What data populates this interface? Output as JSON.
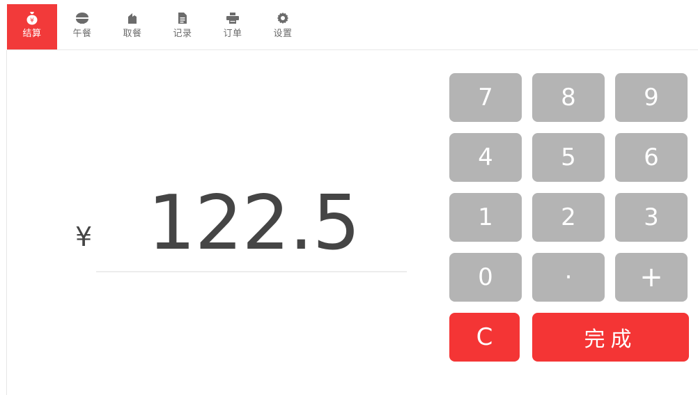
{
  "nav": {
    "tabs": [
      {
        "label": "结算",
        "icon": "money-bag-icon",
        "active": true
      },
      {
        "label": "午餐",
        "icon": "rice-bowl-icon",
        "active": false
      },
      {
        "label": "取餐",
        "icon": "pickup-box-icon",
        "active": false
      },
      {
        "label": "记录",
        "icon": "document-icon",
        "active": false
      },
      {
        "label": "订单",
        "icon": "printer-icon",
        "active": false
      },
      {
        "label": "设置",
        "icon": "gear-icon",
        "active": false
      }
    ]
  },
  "display": {
    "currency": "¥",
    "amount": "122.5"
  },
  "keypad": {
    "k7": "7",
    "k8": "8",
    "k9": "9",
    "k4": "4",
    "k5": "5",
    "k6": "6",
    "k1": "1",
    "k2": "2",
    "k3": "3",
    "k0": "0",
    "dot": "·",
    "plus": "+",
    "clear": "C",
    "done": "完成"
  },
  "colors": {
    "accent": "#f23a3a",
    "key_gray": "#b4b4b4",
    "text": "#454545"
  }
}
